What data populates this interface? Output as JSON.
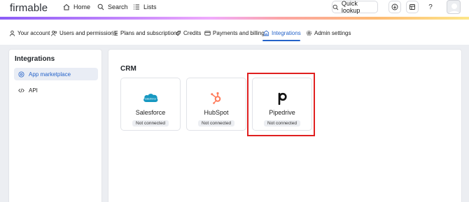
{
  "topnav": {
    "logo": "firmable",
    "links": [
      {
        "label": "Home",
        "icon": "home-icon"
      },
      {
        "label": "Search",
        "icon": "search-icon"
      },
      {
        "label": "Lists",
        "icon": "list-icon"
      }
    ],
    "quick_lookup": "Quick lookup",
    "help": "?"
  },
  "subnav": {
    "items": [
      {
        "label": "Your account",
        "icon": "user-icon"
      },
      {
        "label": "Users and permissions",
        "icon": "users-icon"
      },
      {
        "label": "Plans and subscriptions",
        "icon": "list-icon"
      },
      {
        "label": "Credits",
        "icon": "tag-icon"
      },
      {
        "label": "Payments and billing",
        "icon": "card-icon"
      },
      {
        "label": "Integrations",
        "icon": "puzzle-icon"
      },
      {
        "label": "Admin settings",
        "icon": "gear-icon"
      }
    ],
    "active": "Integrations"
  },
  "sidebar": {
    "title": "Integrations",
    "items": [
      {
        "label": "App marketplace",
        "icon": "marketplace-icon",
        "selected": true
      },
      {
        "label": "API",
        "icon": "code-icon",
        "selected": false
      }
    ]
  },
  "main": {
    "section_title": "CRM",
    "cards": [
      {
        "name": "Salesforce",
        "status": "Not connected",
        "logo": "salesforce-logo"
      },
      {
        "name": "HubSpot",
        "status": "Not connected",
        "logo": "hubspot-logo"
      },
      {
        "name": "Pipedrive",
        "status": "Not connected",
        "logo": "pipedrive-logo"
      }
    ]
  },
  "colors": {
    "accent": "#2563c9",
    "highlight": "#e02020",
    "salesforce": "#1798c1",
    "hubspot": "#ff7a59"
  }
}
